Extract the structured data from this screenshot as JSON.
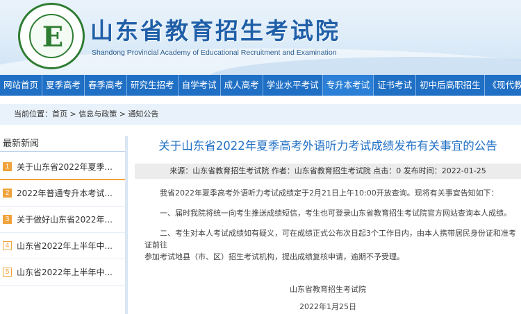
{
  "header": {
    "logo_letter": "E",
    "title": "山东省教育招生考试院",
    "subtitle": "Shandong Provincial Academy of Educational Recruitment and Examination"
  },
  "nav": {
    "items": [
      {
        "label": "网站首页"
      },
      {
        "label": "夏季高考"
      },
      {
        "label": "春季高考"
      },
      {
        "label": "研究生招考"
      },
      {
        "label": "自学考试"
      },
      {
        "label": "成人高考"
      },
      {
        "label": "学业水平考试"
      },
      {
        "label": "专升本考试"
      },
      {
        "label": "证书考试"
      },
      {
        "label": "初中后高职招生"
      },
      {
        "label": "《现代教育》"
      }
    ],
    "active_index": 7
  },
  "breadcrumb": {
    "prefix": "当前位置：",
    "items": [
      "首页",
      "信息与政策",
      "通知公告"
    ],
    "separator": " > "
  },
  "sidebar": {
    "title": "最新新闻",
    "items": [
      {
        "num": "1",
        "text": "关于山东省2022年夏季..."
      },
      {
        "num": "2",
        "text": "2022年普通专升本考试..."
      },
      {
        "num": "3",
        "text": "关于做好山东省2022年..."
      },
      {
        "num": "4",
        "text": "山东省2022年上半年中..."
      },
      {
        "num": "5",
        "text": "山东省2022年上半年中..."
      }
    ]
  },
  "article": {
    "title": "关于山东省2022年夏季高考外语听力考试成绩发布有关事宜的公告",
    "meta": "来源：山东省教育招生考试院 作者：山东省教育招生考试院 点击：0 发布时间：2022-01-25",
    "paragraphs": [
      "我省2022年夏季高考外语听力考试成绩定于2月21日上午10:00开放查询。现将有关事宜告知如下：",
      "一、届时我院将统一向考生推送成绩短信，考生也可登录山东省教育招生考试院官方网站查询本人成绩。",
      "二、考生对本人考试成绩如有疑义，可在成绩正式公布次日起3个工作日内，由本人携带居民身份证和准考证前往",
      "参加考试地县（市、区）招生考试机构，提出成绩复核申请，逾期不予受理。"
    ],
    "signature": "山东省教育招生考试院",
    "date": "2022年1月25日"
  }
}
